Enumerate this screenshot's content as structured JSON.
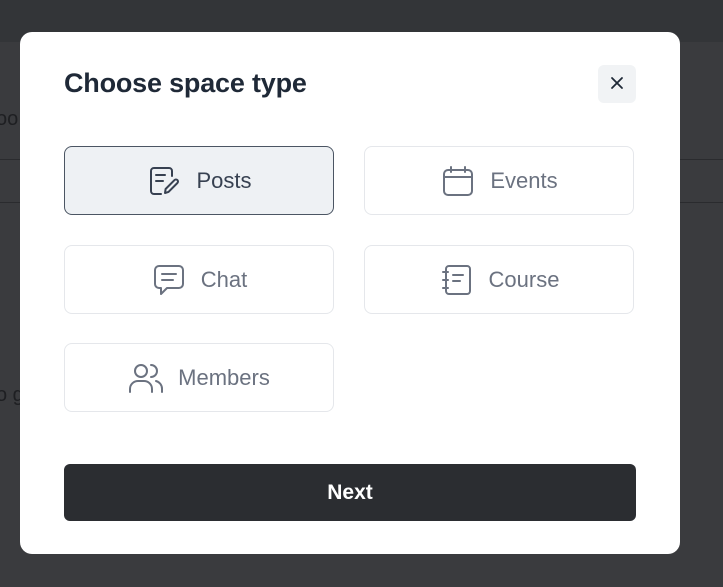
{
  "background": {
    "partial_text_1": "oo",
    "partial_text_2": "o g"
  },
  "dialog": {
    "title": "Choose space type",
    "close_icon": "close-icon",
    "options": [
      {
        "label": "Posts",
        "icon": "pencil-note-icon",
        "selected": true
      },
      {
        "label": "Events",
        "icon": "calendar-icon",
        "selected": false
      },
      {
        "label": "Chat",
        "icon": "chat-bubble-icon",
        "selected": false
      },
      {
        "label": "Course",
        "icon": "notebook-icon",
        "selected": false
      },
      {
        "label": "Members",
        "icon": "users-icon",
        "selected": false
      }
    ],
    "next_label": "Next"
  },
  "colors": {
    "overlay": "#333538",
    "selected_bg": "#eef1f4",
    "selected_border": "#4b5563",
    "primary_button": "#2b2d31"
  }
}
